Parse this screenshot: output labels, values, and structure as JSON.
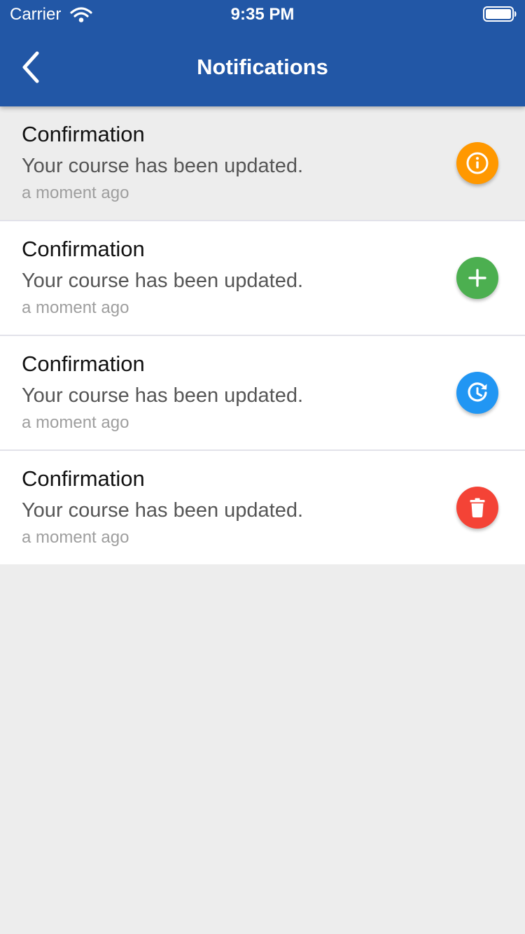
{
  "status_bar": {
    "carrier": "Carrier",
    "time": "9:35 PM",
    "wifi_icon": "wifi-icon",
    "battery_icon": "battery-full-icon"
  },
  "nav": {
    "title": "Notifications",
    "back_icon": "chevron-left-icon"
  },
  "colors": {
    "header": "#2257a6",
    "info": "#ff9800",
    "add": "#4caf50",
    "history": "#2196f3",
    "delete": "#f44336",
    "read_background": "#ededed"
  },
  "notifications": [
    {
      "title": "Confirmation",
      "message": "Your course has been updated.",
      "time": "a moment ago",
      "icon": "info-icon",
      "read": true
    },
    {
      "title": "Confirmation",
      "message": "Your course has been updated.",
      "time": "a moment ago",
      "icon": "plus-icon",
      "read": false
    },
    {
      "title": "Confirmation",
      "message": "Your course has been updated.",
      "time": "a moment ago",
      "icon": "history-icon",
      "read": false
    },
    {
      "title": "Confirmation",
      "message": "Your course has been updated.",
      "time": "a moment ago",
      "icon": "trash-icon",
      "read": false
    }
  ]
}
